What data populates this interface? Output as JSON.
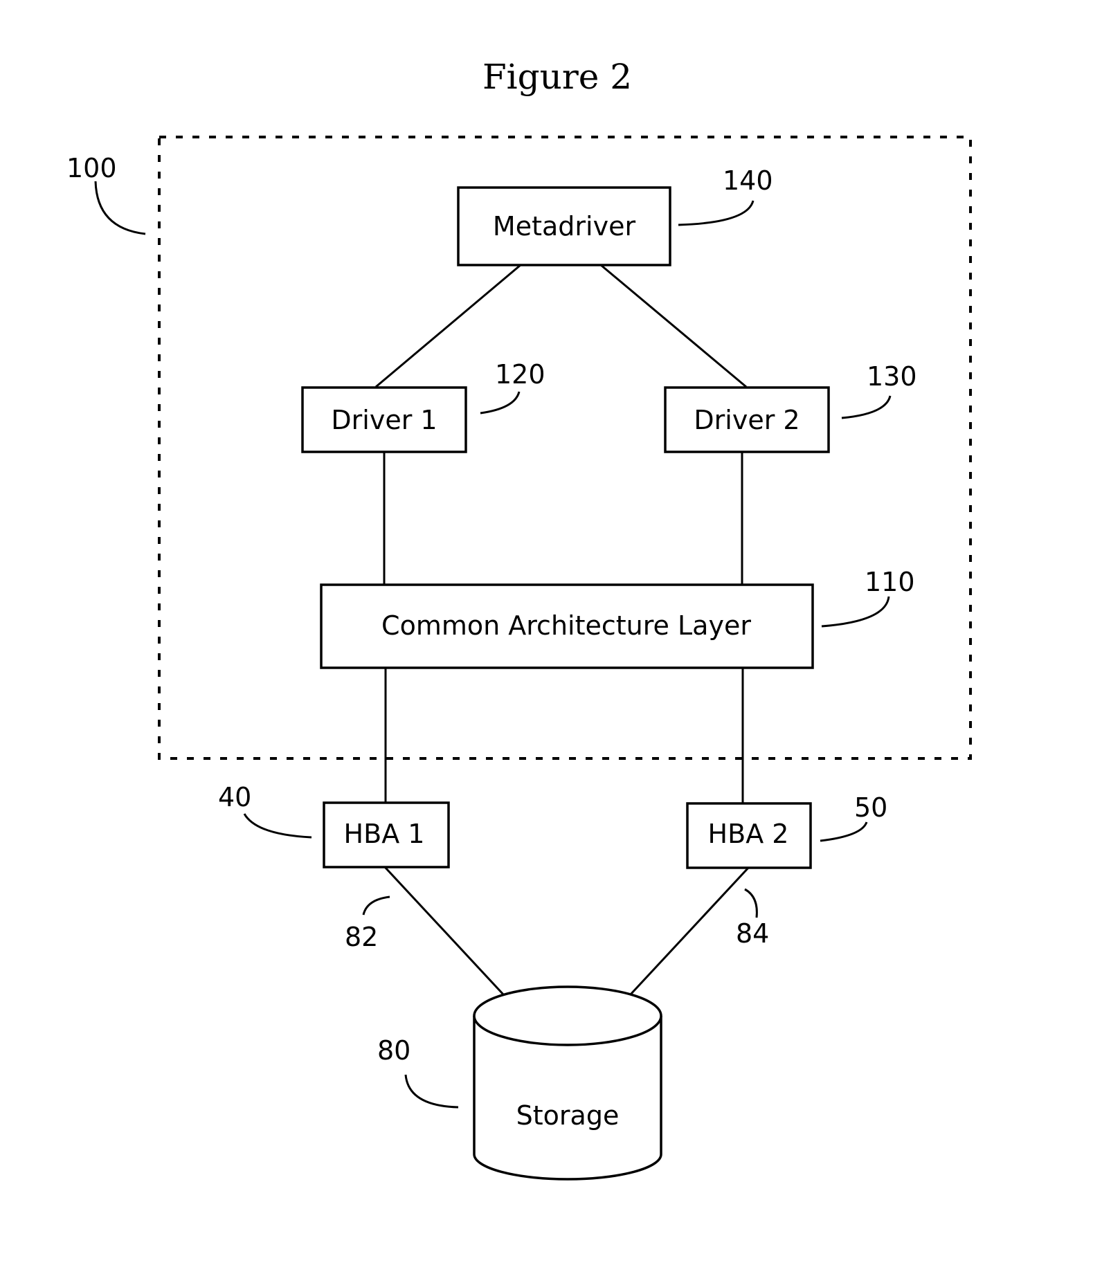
{
  "figure": {
    "title": "Figure 2"
  },
  "diagram": {
    "boundary": {
      "ref": "100"
    },
    "nodes": {
      "metadriver": {
        "label": "Metadriver",
        "ref": "140"
      },
      "driver1": {
        "label": "Driver 1",
        "ref": "120"
      },
      "driver2": {
        "label": "Driver 2",
        "ref": "130"
      },
      "cal": {
        "label": "Common Architecture Layer",
        "ref": "110"
      },
      "hba1": {
        "label": "HBA 1",
        "ref": "40"
      },
      "hba2": {
        "label": "HBA 2",
        "ref": "50"
      },
      "storage": {
        "label": "Storage",
        "ref": "80"
      }
    },
    "links": {
      "hba1_storage": {
        "ref": "82"
      },
      "hba2_storage": {
        "ref": "84"
      }
    },
    "edges": [
      [
        "metadriver",
        "driver1"
      ],
      [
        "metadriver",
        "driver2"
      ],
      [
        "driver1",
        "cal"
      ],
      [
        "driver2",
        "cal"
      ],
      [
        "cal",
        "hba1"
      ],
      [
        "cal",
        "hba2"
      ],
      [
        "hba1",
        "storage"
      ],
      [
        "hba2",
        "storage"
      ]
    ]
  }
}
